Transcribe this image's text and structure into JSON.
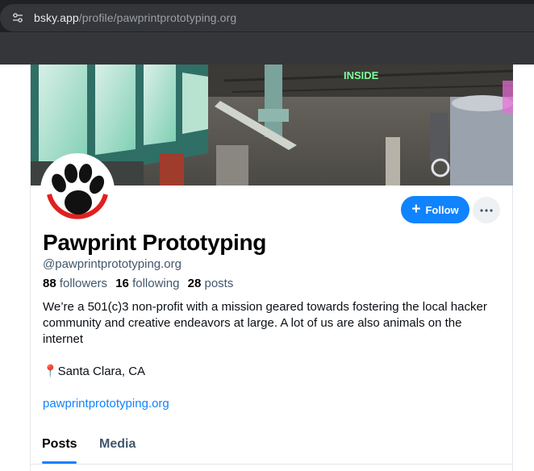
{
  "browser": {
    "url_host": "bsky.app",
    "url_path": "/profile/pawprintprototyping.org",
    "site_info_icon": "tune-icon"
  },
  "banner": {
    "neon_sign_text": "INSIDE"
  },
  "profile": {
    "display_name": "Pawprint Prototyping",
    "handle": "@pawprintprototyping.org",
    "followers_count": "88",
    "followers_label": "followers",
    "following_count": "16",
    "following_label": "following",
    "posts_count": "28",
    "posts_label": "posts",
    "bio_line1": "We’re a 501(c)3 non-profit with a mission geared towards fostering the local hacker community and creative endeavors at large. A lot of us are also animals on the internet",
    "bio_location": "📍Santa Clara, CA",
    "bio_link": "pawprintprototyping.org"
  },
  "actions": {
    "follow_label": "Follow",
    "follow_icon": "plus-icon",
    "more_icon": "ellipsis-icon"
  },
  "tabs": [
    {
      "label": "Posts",
      "active": true
    },
    {
      "label": "Media",
      "active": false
    }
  ],
  "colors": {
    "accent": "#1083fe",
    "secondary_text": "#42576c",
    "chrome_bg": "#202124"
  }
}
